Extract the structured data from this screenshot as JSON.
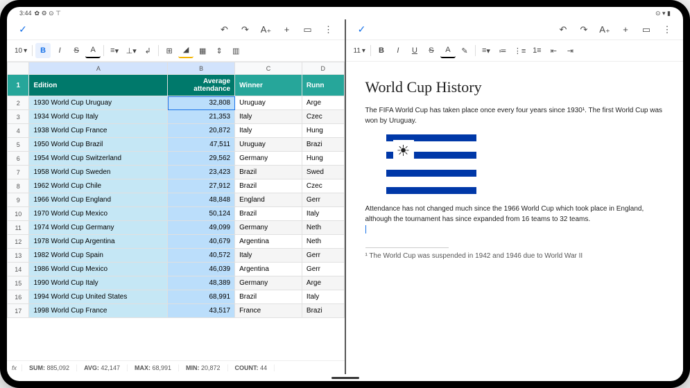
{
  "status": {
    "time": "3:44",
    "icons_left": "✿ ⚙ ⊙ ⊤",
    "icons_right": "⊙ ▾ ▮"
  },
  "sheets": {
    "topbar": {
      "undo": "↶",
      "redo": "↷",
      "textfmt": "A₊",
      "add": "+",
      "comment": "▭",
      "more": "⋮"
    },
    "toolbar": {
      "fontsize": "10",
      "caret": "▾",
      "bold": "B",
      "italic": "I",
      "strike": "S",
      "underA": "A",
      "halign": "≡",
      "valign": "⊥",
      "wrap": "↲",
      "merge": "⊞",
      "fill": "◢",
      "border": "▦",
      "hgt": "⇕",
      "cols": "▥"
    },
    "cols": [
      "A",
      "B",
      "C",
      "D"
    ],
    "headers": {
      "A": "Edition",
      "B": "Average attendance",
      "C": "Winner",
      "D": "Runn"
    },
    "rows": [
      {
        "n": "1",
        "A": "1930 World Cup Uruguay",
        "B": "32,808",
        "C": "Uruguay",
        "D": "Arge"
      },
      {
        "n": "2",
        "A": "1934 World Cup Italy",
        "B": "21,353",
        "C": "Italy",
        "D": "Czec"
      },
      {
        "n": "3",
        "A": "1938 World Cup France",
        "B": "20,872",
        "C": "Italy",
        "D": "Hung"
      },
      {
        "n": "4",
        "A": "1950 World Cup Brazil",
        "B": "47,511",
        "C": "Uruguay",
        "D": "Brazi"
      },
      {
        "n": "5",
        "A": "1954 World Cup Switzerland",
        "B": "29,562",
        "C": "Germany",
        "D": "Hung"
      },
      {
        "n": "6",
        "A": "1958 World Cup Sweden",
        "B": "23,423",
        "C": "Brazil",
        "D": "Swed"
      },
      {
        "n": "7",
        "A": "1962 World Cup Chile",
        "B": "27,912",
        "C": "Brazil",
        "D": "Czec"
      },
      {
        "n": "8",
        "A": "1966 World Cup England",
        "B": "48,848",
        "C": "England",
        "D": "Gerr"
      },
      {
        "n": "9",
        "A": "1970 World Cup Mexico",
        "B": "50,124",
        "C": "Brazil",
        "D": "Italy"
      },
      {
        "n": "10",
        "A": "1974 World Cup Germany",
        "B": "49,099",
        "C": "Germany",
        "D": "Neth"
      },
      {
        "n": "11",
        "A": "1978 World Cup Argentina",
        "B": "40,679",
        "C": "Argentina",
        "D": "Neth"
      },
      {
        "n": "12",
        "A": "1982 World Cup Spain",
        "B": "40,572",
        "C": "Italy",
        "D": "Gerr"
      },
      {
        "n": "13",
        "A": "1986 World Cup Mexico",
        "B": "46,039",
        "C": "Argentina",
        "D": "Gerr"
      },
      {
        "n": "14",
        "A": "1990 World Cup Italy",
        "B": "48,389",
        "C": "Germany",
        "D": "Arge"
      },
      {
        "n": "15",
        "A": "1994 World Cup United States",
        "B": "68,991",
        "C": "Brazil",
        "D": "Italy"
      },
      {
        "n": "16",
        "A": "1998 World Cup France",
        "B": "43,517",
        "C": "France",
        "D": "Brazi"
      }
    ],
    "stats": {
      "sum_l": "SUM:",
      "sum": "885,092",
      "avg_l": "AVG:",
      "avg": "42,147",
      "max_l": "MAX:",
      "max": "68,991",
      "min_l": "MIN:",
      "min": "20,872",
      "cnt_l": "COUNT:",
      "cnt": "44"
    },
    "fx": "fx"
  },
  "docs": {
    "topbar": {
      "undo": "↶",
      "redo": "↷",
      "textfmt": "A₊",
      "add": "+",
      "comment": "▭",
      "more": "⋮"
    },
    "toolbar": {
      "fontsize": "11",
      "caret": "▾",
      "bold": "B",
      "italic": "I",
      "under": "U",
      "strike": "S",
      "underA": "A",
      "pen": "✎",
      "align": "≡",
      "lh": "≔",
      "bullet": "⋮≡",
      "numlist": "1≡",
      "outdent": "⇤",
      "indent": "⇥"
    },
    "title": "World Cup History",
    "p1": "The FIFA World Cup has taken place once every four years since 1930¹. The first World Cup was won by Uruguay.",
    "p2": "Attendance has not changed much since the 1966 World Cup which took place in England, although the tournament has since expanded from 16 teams to 32 teams.",
    "footnote": "¹ The World Cup was suspended in 1942 and 1946 due to World War II"
  }
}
